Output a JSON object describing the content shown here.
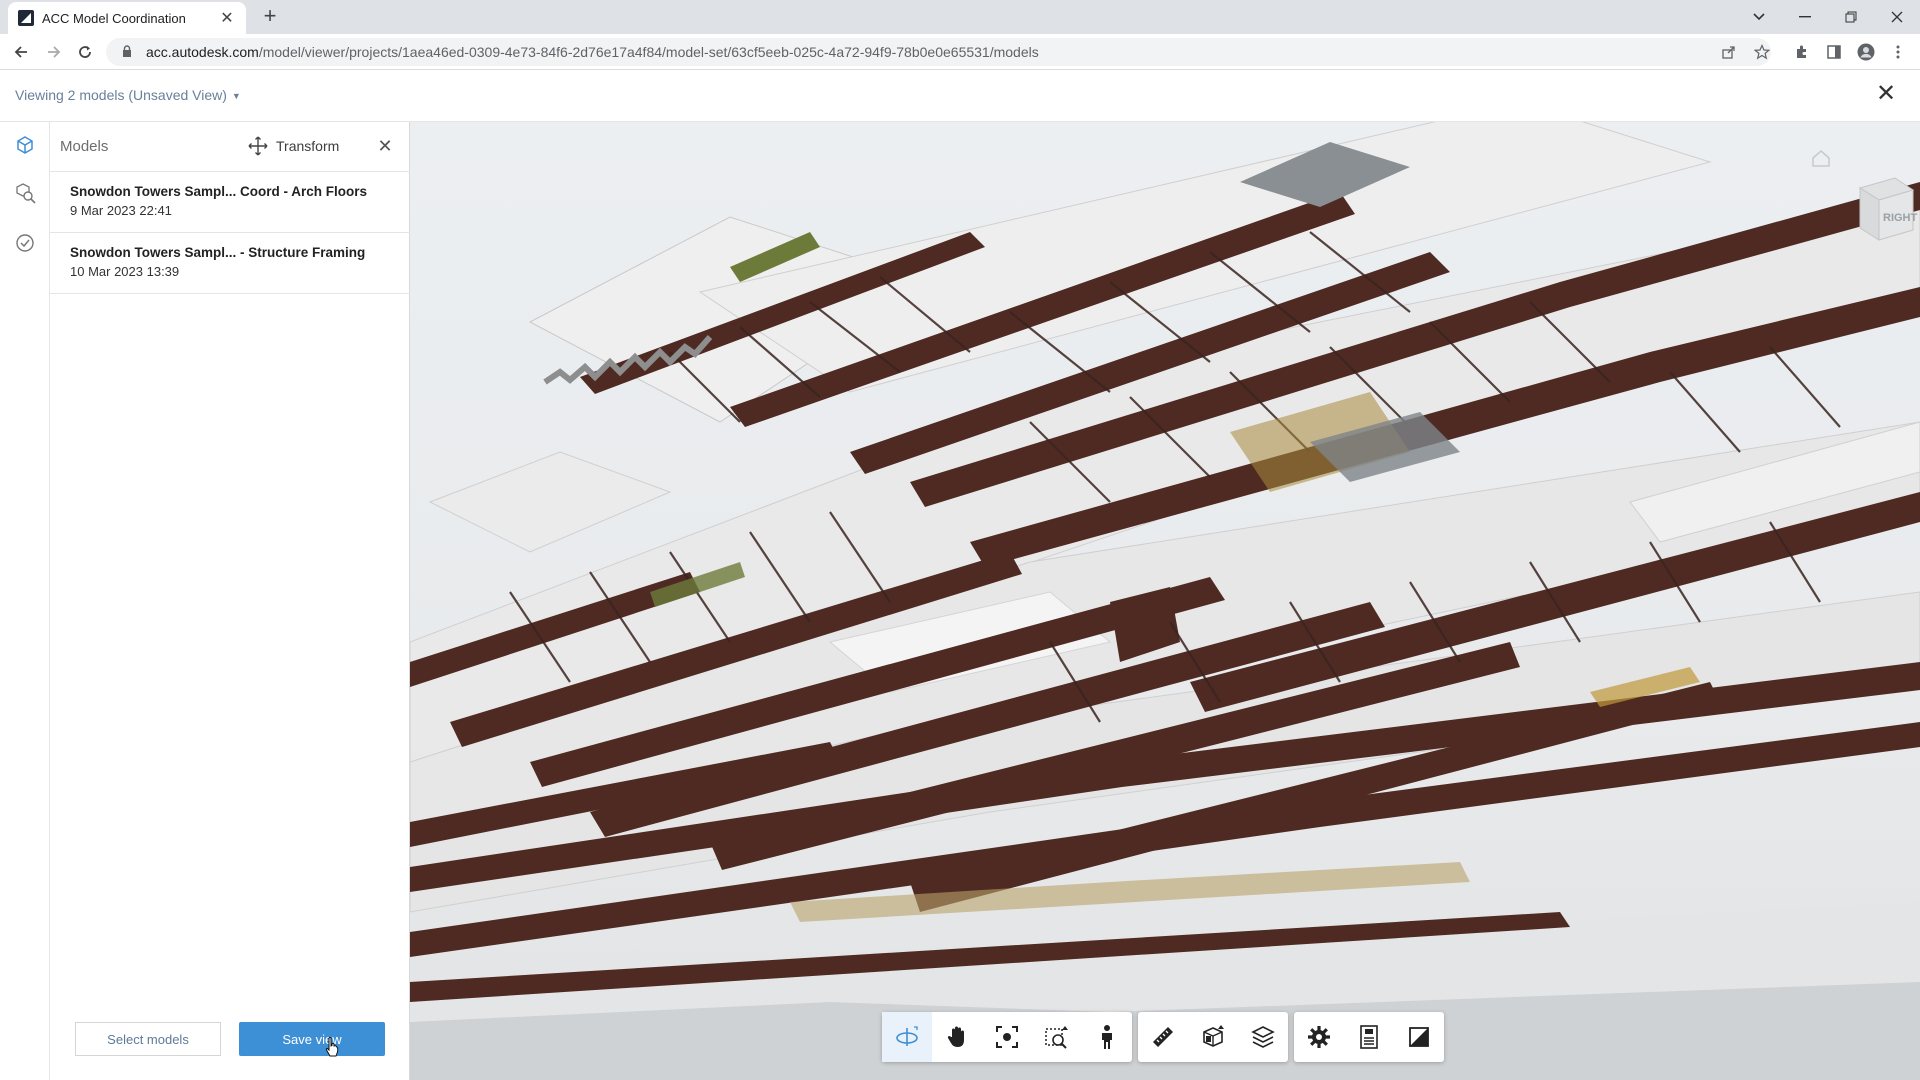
{
  "browser": {
    "tab_title": "ACC Model Coordination",
    "tab_close": "✕",
    "new_tab": "+",
    "url_host": "acc.autodesk.com",
    "url_path": "/model/viewer/projects/1aea46ed-0309-4e73-84f6-2d76e17a4f84/model-set/63cf5eeb-025c-4a72-94f9-78b0e0e65531/models"
  },
  "header": {
    "viewing_label": "Viewing 2 models (Unsaved View)",
    "close": "✕"
  },
  "panel": {
    "title": "Models",
    "transform_label": "Transform",
    "close": "✕",
    "models": [
      {
        "name": "Snowdon Towers Sampl... Coord - Arch Floors",
        "date": "9 Mar 2023 22:41"
      },
      {
        "name": "Snowdon Towers Sampl... - Structure Framing",
        "date": "10 Mar 2023 13:39"
      }
    ],
    "select_models_label": "Select models",
    "save_view_label": "Save view"
  },
  "viewer": {
    "viewcube_label": "RIGHT",
    "toolbar": {
      "nav_tools": [
        "orbit-icon",
        "pan-icon",
        "fit-to-view-icon",
        "zoom-window-icon",
        "first-person-icon"
      ],
      "analysis_tools": [
        "measure-icon",
        "section-icon",
        "layers-icon"
      ],
      "settings_tools": [
        "settings-icon",
        "properties-icon",
        "fullscreen-icon"
      ],
      "active_tool": "orbit-icon"
    }
  },
  "colors": {
    "accent": "#3d8fd6",
    "link": "#6a7f9a",
    "beam": "#4e2a23",
    "slab": "#e6e6e6"
  }
}
